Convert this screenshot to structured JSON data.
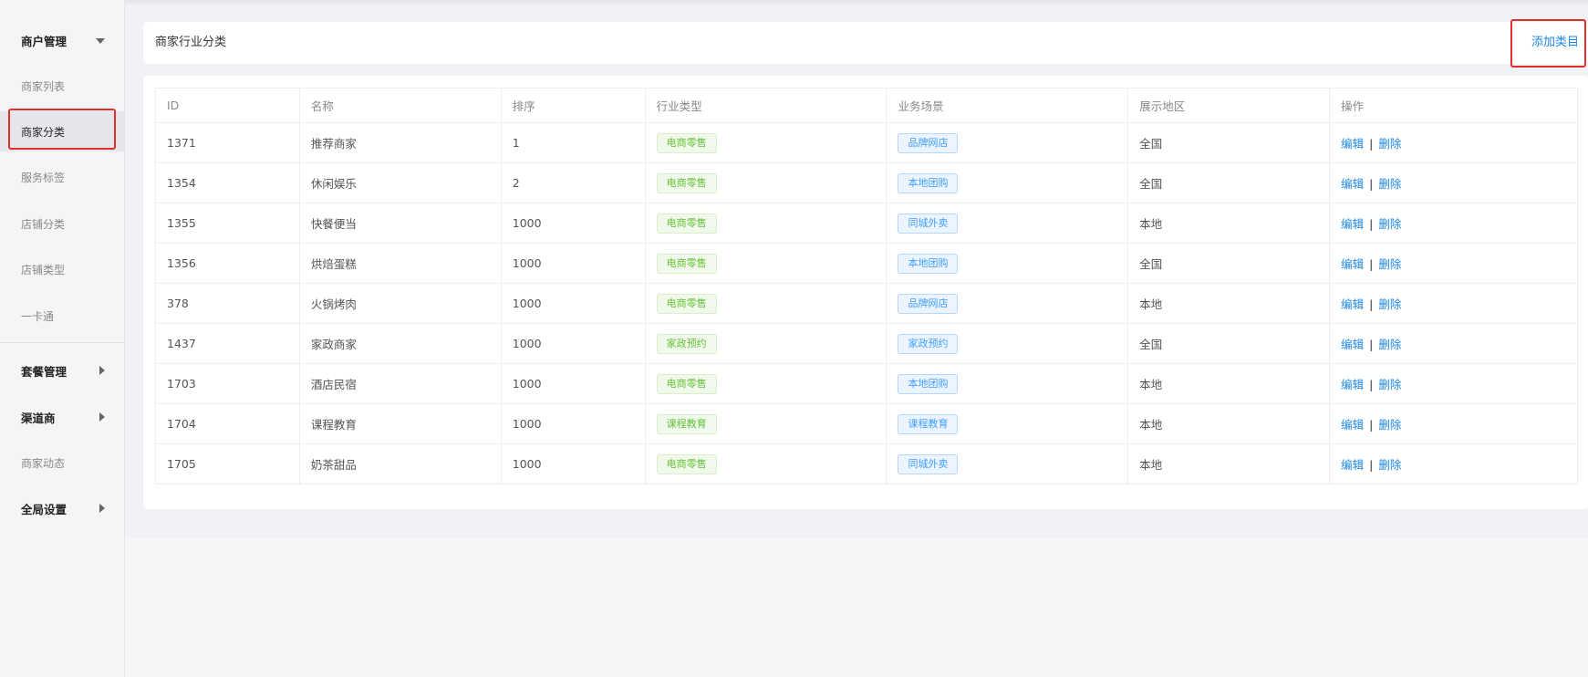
{
  "sidebar": {
    "items": [
      {
        "label": "商户管理",
        "group": true,
        "caret": "down"
      },
      {
        "label": "商家列表"
      },
      {
        "label": "商家分类",
        "active": true
      },
      {
        "label": "服务标签"
      },
      {
        "label": "店铺分类"
      },
      {
        "label": "店铺类型"
      },
      {
        "label": "一卡通"
      },
      {
        "label": "套餐管理",
        "group": true,
        "caret": "right"
      },
      {
        "label": "渠道商",
        "group": true,
        "caret": "right"
      },
      {
        "label": "商家动态"
      },
      {
        "label": "全局设置",
        "group": true,
        "caret": "right"
      }
    ]
  },
  "header": {
    "title": "商家行业分类",
    "add_label": "添加类目"
  },
  "table": {
    "columns": [
      "ID",
      "名称",
      "排序",
      "行业类型",
      "业务场景",
      "展示地区",
      "操作"
    ],
    "rows": [
      {
        "id": "1371",
        "name": "推荐商家",
        "sort": "1",
        "industry": "电商零售",
        "scene": "品牌网店",
        "region": "全国"
      },
      {
        "id": "1354",
        "name": "休闲娱乐",
        "sort": "2",
        "industry": "电商零售",
        "scene": "本地团购",
        "region": "全国"
      },
      {
        "id": "1355",
        "name": "快餐便当",
        "sort": "1000",
        "industry": "电商零售",
        "scene": "同城外卖",
        "region": "本地"
      },
      {
        "id": "1356",
        "name": "烘焙蛋糕",
        "sort": "1000",
        "industry": "电商零售",
        "scene": "本地团购",
        "region": "全国"
      },
      {
        "id": "378",
        "name": "火锅烤肉",
        "sort": "1000",
        "industry": "电商零售",
        "scene": "品牌网店",
        "region": "本地"
      },
      {
        "id": "1437",
        "name": "家政商家",
        "sort": "1000",
        "industry": "家政预约",
        "scene": "家政预约",
        "region": "全国"
      },
      {
        "id": "1703",
        "name": "酒店民宿",
        "sort": "1000",
        "industry": "电商零售",
        "scene": "本地团购",
        "region": "本地"
      },
      {
        "id": "1704",
        "name": "课程教育",
        "sort": "1000",
        "industry": "课程教育",
        "scene": "课程教育",
        "region": "本地"
      },
      {
        "id": "1705",
        "name": "奶茶甜品",
        "sort": "1000",
        "industry": "电商零售",
        "scene": "同城外卖",
        "region": "本地"
      }
    ],
    "edit_label": "编辑",
    "separator": "|",
    "delete_label": "删除"
  },
  "colors": {
    "accent": "#1e88e5",
    "highlight_border": "#e32d2d",
    "industry_tag": "#67c23a",
    "scene_tag": "#409eff"
  }
}
